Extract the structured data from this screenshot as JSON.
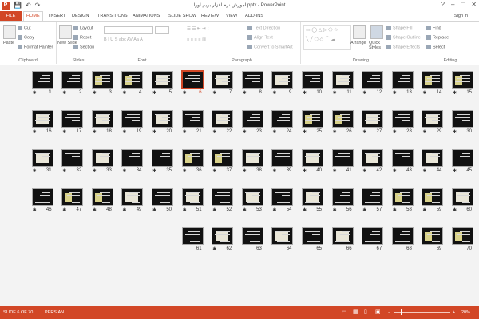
{
  "window": {
    "title": "آموزش نرم افزار بریم اورا.pptx - PowerPoint",
    "sign_in": "Sign in",
    "controls": [
      "?",
      "–",
      "□",
      "✕"
    ]
  },
  "quick_access": [
    "💾",
    "↶",
    "↷"
  ],
  "tabs": [
    "FILE",
    "HOME",
    "INSERT",
    "DESIGN",
    "TRANSITIONS",
    "ANIMATIONS",
    "SLIDE SHOW",
    "REVIEW",
    "VIEW",
    "ADD-INS"
  ],
  "active_tab": "HOME",
  "ribbon": {
    "clipboard": {
      "label": "Clipboard",
      "paste": "Paste",
      "cut": "Cut",
      "copy": "Copy",
      "format_painter": "Format Painter"
    },
    "slides": {
      "label": "Slides",
      "new_slide": "New Slide",
      "layout": "Layout",
      "reset": "Reset",
      "section": "Section"
    },
    "font": {
      "label": "Font"
    },
    "paragraph": {
      "label": "Paragraph",
      "text_direction": "Text Direction",
      "align_text": "Align Text",
      "convert_smartart": "Convert to SmartArt"
    },
    "drawing": {
      "label": "Drawing",
      "arrange": "Arrange",
      "quick_styles": "Quick Styles",
      "shape_fill": "Shape Fill",
      "shape_outline": "Shape Outline",
      "shape_effects": "Shape Effects"
    },
    "editing": {
      "label": "Editing",
      "find": "Find",
      "replace": "Replace",
      "select": "Select"
    }
  },
  "slide_sorter": {
    "selected": "6",
    "star_glyph": "✱",
    "rows": [
      [
        "15",
        "14",
        "13",
        "12",
        "11",
        "10",
        "9",
        "8",
        "7",
        "6",
        "5",
        "4",
        "3",
        "2",
        "1"
      ],
      [
        "30",
        "29",
        "28",
        "27",
        "26",
        "25",
        "24",
        "23",
        "22",
        "21",
        "20",
        "19",
        "18",
        "17",
        "16"
      ],
      [
        "45",
        "44",
        "43",
        "42",
        "41",
        "40",
        "39",
        "38",
        "37",
        "36",
        "35",
        "34",
        "33",
        "32",
        "31"
      ],
      [
        "60",
        "59",
        "58",
        "57",
        "56",
        "55",
        "54",
        "53",
        "52",
        "51",
        "50",
        "49",
        "48",
        "47",
        "46"
      ],
      [
        "70",
        "69",
        "68",
        "67",
        "66",
        "65",
        "64",
        "63",
        "62",
        "61"
      ]
    ],
    "star_rows": [
      [
        "15",
        "14",
        "13",
        "12",
        "11",
        "10",
        "9",
        "8",
        "7",
        "6",
        "5",
        "4",
        "3",
        "2",
        "1"
      ],
      [
        "30",
        "29",
        "28",
        "27",
        "26",
        "25",
        "24",
        "23",
        "22",
        "21",
        "20",
        "19",
        "18",
        "17",
        "16"
      ],
      [
        "45",
        "44",
        "43",
        "42",
        "41",
        "40",
        "39",
        "38",
        "37",
        "36",
        "35",
        "34",
        "33",
        "32",
        "31"
      ],
      [
        "60",
        "59",
        "58",
        "57",
        "56",
        "55",
        "54",
        "53",
        "52",
        "51",
        "50",
        "49",
        "48",
        "47",
        "46"
      ],
      [
        "62"
      ]
    ]
  },
  "status_bar": {
    "slide_info": "SLIDE 6 OF 70",
    "language": "PERSIAN",
    "zoom": "20%",
    "zoom_minus": "−",
    "zoom_plus": "+"
  },
  "colors": {
    "accent": "#d24726",
    "ribbon_bg": "#ffffff",
    "sorter_bg": "#f3f3f3"
  }
}
